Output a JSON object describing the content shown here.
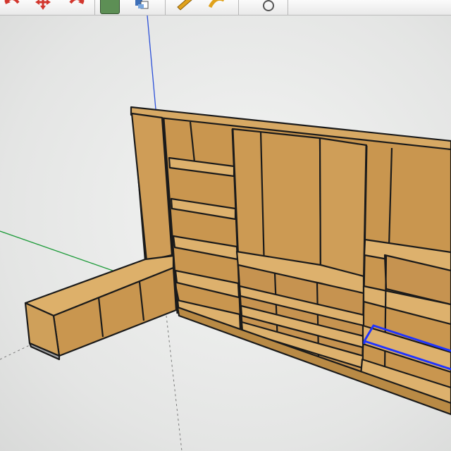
{
  "toolbar": {
    "tools": [
      {
        "name": "undo-icon",
        "color": "#d2362d"
      },
      {
        "name": "move-icon",
        "color": "#d2362d"
      },
      {
        "name": "redo-icon",
        "color": "#d2362d"
      },
      {
        "name": "component-icon",
        "color": "#4f8a4f"
      },
      {
        "name": "materials-icon",
        "color": "#3d6fb8"
      },
      {
        "name": "pencil-icon",
        "color": "#e0a21c"
      },
      {
        "name": "push-pull-icon",
        "color": "#e0a21c"
      },
      {
        "name": "orbit-icon",
        "color": "#555555"
      }
    ]
  },
  "scene": {
    "wood_color": "#c9964f",
    "wood_dark": "#a8793a",
    "edge_color": "#1a1a1a",
    "selection_color": "#1f34ff",
    "axis_green": "#1e9b3a",
    "axis_blue": "#2b4fd8"
  }
}
